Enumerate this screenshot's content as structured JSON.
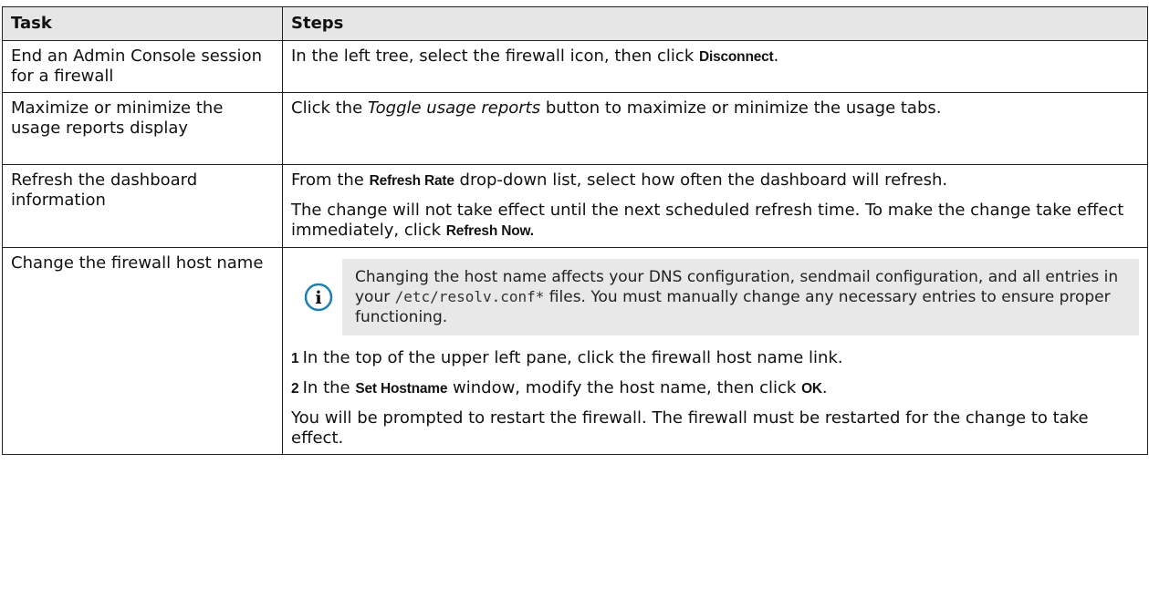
{
  "headers": {
    "task": "Task",
    "steps": "Steps"
  },
  "rows": [
    {
      "task": "End an Admin Console session for a firewall",
      "steps": {
        "pre": "In the left tree, select the firewall icon, then click ",
        "ui": "Disconnect",
        "post": "."
      }
    },
    {
      "task": "Maximize or minimize the usage reports display",
      "steps": {
        "pre": "Click the ",
        "em": "Toggle usage reports",
        "post": " button to maximize or minimize the usage tabs."
      }
    },
    {
      "task": "Refresh the dashboard information",
      "steps": {
        "p1_pre": "From the ",
        "p1_ui": "Refresh Rate",
        "p1_post": " drop-down list, select how often the dashboard will refresh.",
        "p2_pre": "The change will not take effect until the next scheduled refresh time. To make the change take effect immediately, click ",
        "p2_ui": "Refresh Now.",
        "p2_post": ""
      }
    },
    {
      "task": "Change the firewall host name",
      "steps": {
        "note_pre": "Changing the host name affects your DNS configuration, sendmail configuration, and all entries in your ",
        "note_code": "/etc/resolv.conf*",
        "note_post": " files. You must manually change any necessary entries to ensure proper functioning.",
        "step1_num": "1",
        "step1_text": "In the top of the upper left pane, click the firewall host name link.",
        "step2_num": "2",
        "step2_pre": "In the ",
        "step2_ui": "Set Hostname",
        "step2_mid": " window, modify the host name, then click ",
        "step2_ui2": "OK",
        "step2_post": ".",
        "closing": "You will be prompted to restart the firewall. The firewall must be restarted for the change to take effect."
      }
    }
  ],
  "icons": {
    "note": "info-icon",
    "note_color": "#1f7fb3"
  }
}
